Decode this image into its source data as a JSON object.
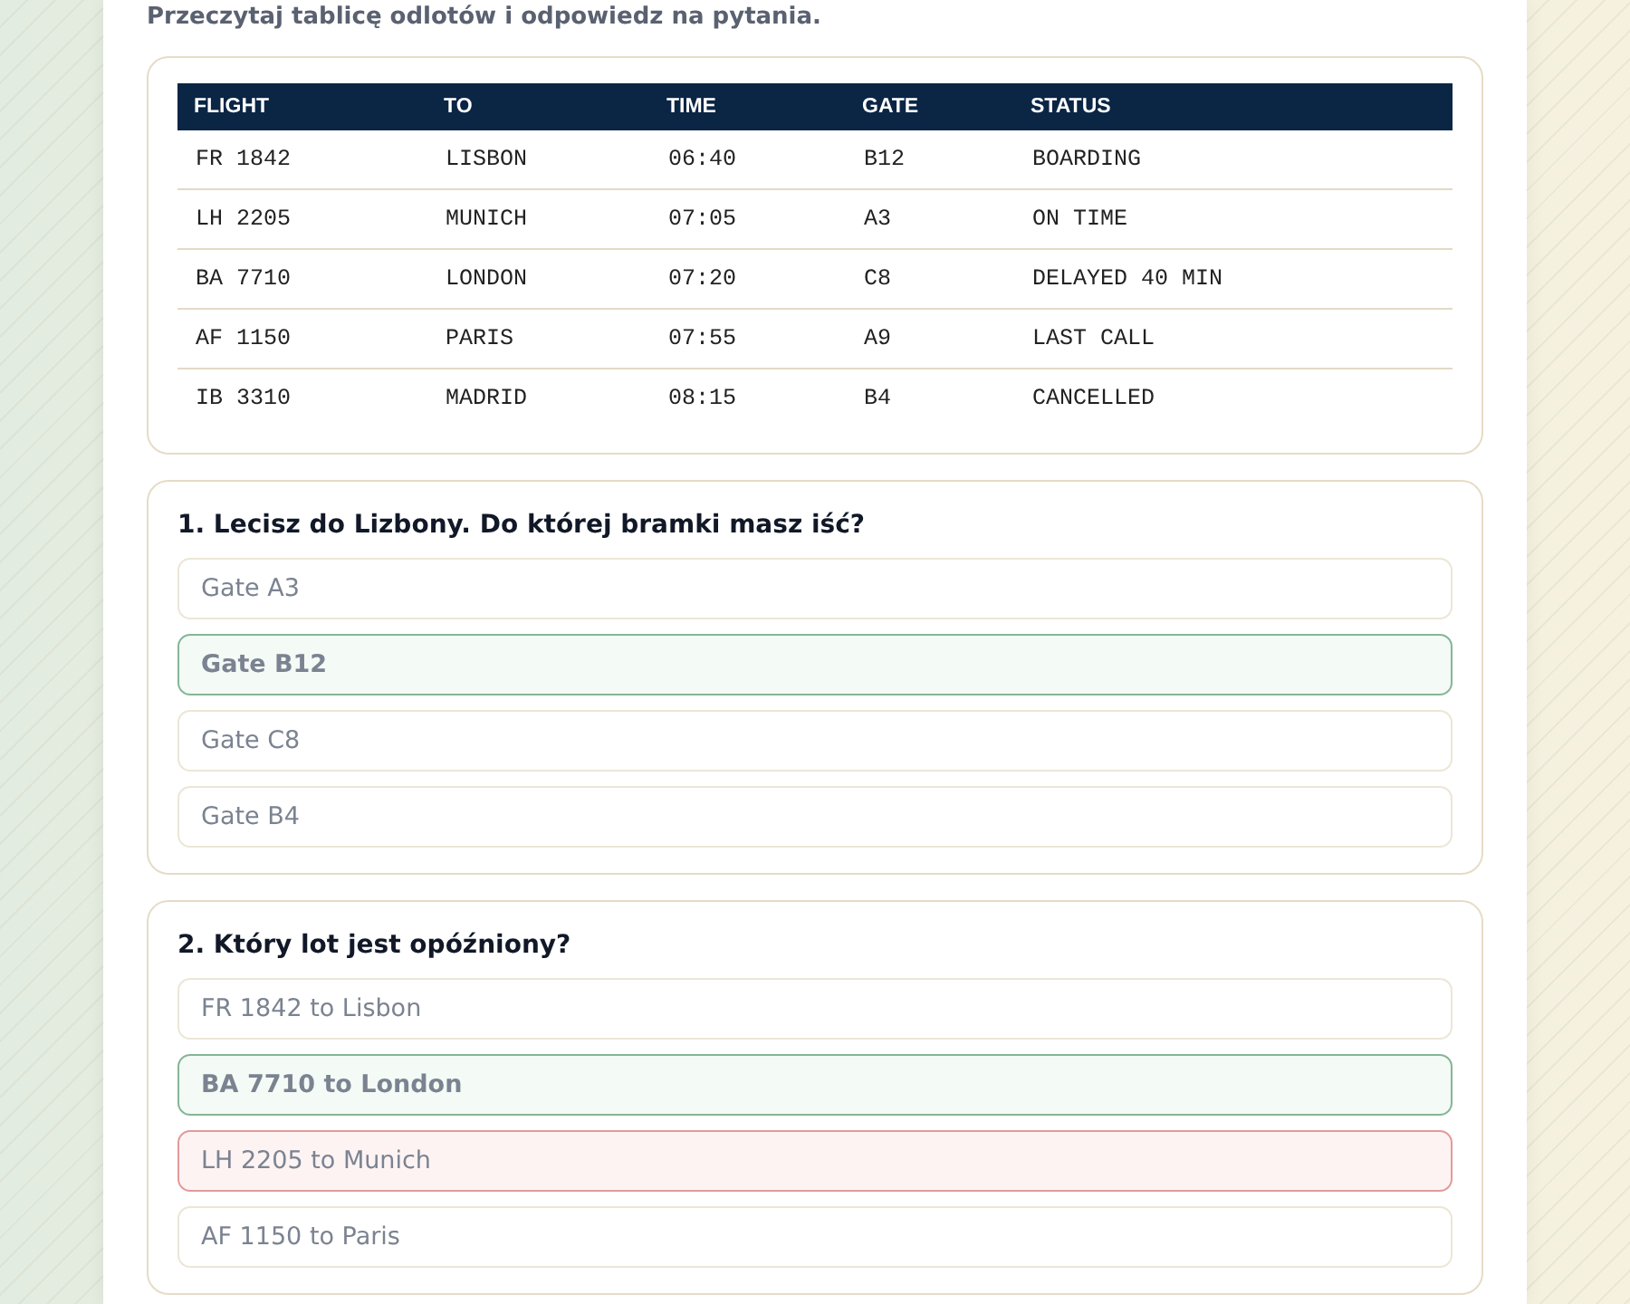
{
  "instruction": "Przeczytaj tablicę odlotów i odpowiedz na pytania.",
  "board": {
    "columns": [
      "FLIGHT",
      "TO",
      "TIME",
      "GATE",
      "STATUS"
    ],
    "rows": [
      [
        "FR 1842",
        "LISBON",
        "06:40",
        "B12",
        "BOARDING"
      ],
      [
        "LH 2205",
        "MUNICH",
        "07:05",
        "A3",
        "ON TIME"
      ],
      [
        "BA 7710",
        "LONDON",
        "07:20",
        "C8",
        "DELAYED 40 MIN"
      ],
      [
        "AF 1150",
        "PARIS",
        "07:55",
        "A9",
        "LAST CALL"
      ],
      [
        "IB 3310",
        "MADRID",
        "08:15",
        "B4",
        "CANCELLED"
      ]
    ]
  },
  "questions": [
    {
      "text": "1. Lecisz do Lizbony. Do której bramki masz iść?",
      "options": [
        {
          "label": "Gate A3",
          "correct": false,
          "wrong": false
        },
        {
          "label": "Gate B12",
          "correct": true,
          "wrong": false
        },
        {
          "label": "Gate C8",
          "correct": false,
          "wrong": false
        },
        {
          "label": "Gate B4",
          "correct": false,
          "wrong": false
        }
      ]
    },
    {
      "text": "2. Który lot jest opóźniony?",
      "options": [
        {
          "label": "FR 1842 to Lisbon",
          "correct": false,
          "wrong": false
        },
        {
          "label": "BA 7710 to London",
          "correct": true,
          "wrong": false
        },
        {
          "label": "LH 2205 to Munich",
          "correct": false,
          "wrong": true
        },
        {
          "label": "AF 1150 to Paris",
          "correct": false,
          "wrong": false
        }
      ]
    }
  ]
}
